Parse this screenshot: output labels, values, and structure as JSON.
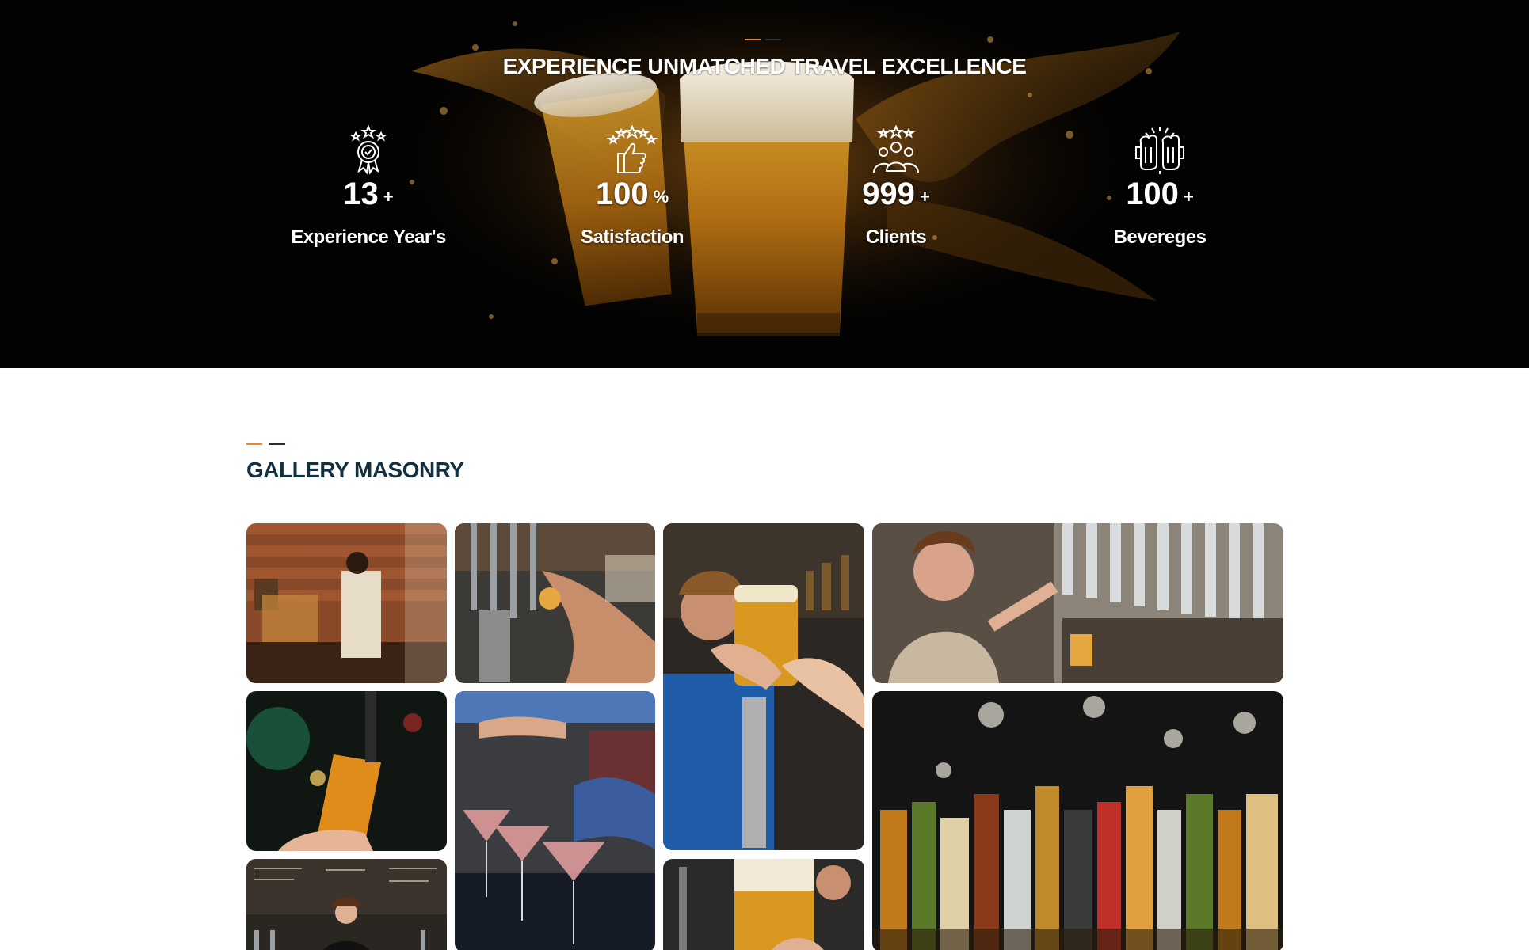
{
  "hero": {
    "title": "EXPERIENCE UNMATCHED TRAVEL EXCELLENCE",
    "stats": [
      {
        "icon": "award-medal-icon",
        "number": "13",
        "suffix": "+",
        "label": "Experience Year's"
      },
      {
        "icon": "thumbs-up-stars-icon",
        "number": "100",
        "suffix": "%",
        "label": "Satisfaction"
      },
      {
        "icon": "group-stars-icon",
        "number": "999",
        "suffix": "+",
        "label": "Clients"
      },
      {
        "icon": "beer-mugs-cheers-icon",
        "number": "100",
        "suffix": "+",
        "label": "Bevereges"
      }
    ]
  },
  "gallery": {
    "title": "GALLERY MASONRY",
    "images": [
      {
        "name": "gallery-image-bartender-brick-wall"
      },
      {
        "name": "gallery-image-beer-taps-pouring"
      },
      {
        "name": "gallery-image-man-holding-beer"
      },
      {
        "name": "gallery-image-woman-pulling-tap"
      },
      {
        "name": "gallery-image-beer-glass-tap"
      },
      {
        "name": "gallery-image-cocktail-pouring"
      },
      {
        "name": "gallery-image-liquor-shelf"
      },
      {
        "name": "gallery-image-staff-chalkboard-menu"
      },
      {
        "name": "gallery-image-beer-close-up"
      }
    ]
  },
  "colors": {
    "accent": "#e8872b",
    "title_dark": "#12303f",
    "hero_bg": "#020202"
  }
}
